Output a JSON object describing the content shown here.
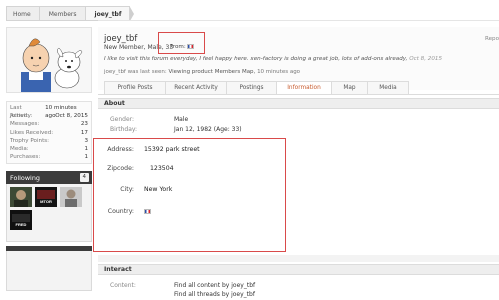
{
  "breadcrumb": [
    "Home",
    "Members",
    "joey_tbf"
  ],
  "profile": {
    "username": "joey_tbf",
    "title": "New Member, Male, 33",
    "from_label": "From:",
    "report": "Repo",
    "status_text": "I like to visit this forum everyday, I feel happy here. xen-factory is doing a great job, lots of add-ons already,",
    "status_date": "Oct 8, 2015",
    "last_seen_prefix": "joey_tbf was last seen:",
    "last_seen_activity": "Viewing product Members Map,",
    "last_seen_time": "10 minutes ago"
  },
  "sidebar": {
    "stats": [
      {
        "label": "Last Activity:",
        "value": "10 minutes ago"
      },
      {
        "label": "Joined:",
        "value": "Oct 8, 2015"
      },
      {
        "label": "Messages:",
        "value": "23"
      },
      {
        "label": "Likes Received:",
        "value": "17"
      },
      {
        "label": "Trophy Points:",
        "value": "3"
      },
      {
        "label": "Media:",
        "value": "1"
      },
      {
        "label": "Purchases:",
        "value": "1"
      }
    ],
    "following_title": "Following",
    "following_count": "4",
    "following_thumbs": [
      "thumb-1",
      "thumb-2",
      "thumb-3",
      "thumb-4"
    ],
    "thumb_texts": [
      "",
      "MTOR",
      "",
      "FRED"
    ]
  },
  "tabs": [
    "Profile Posts",
    "Recent Activity",
    "Postings",
    "Information",
    "Map",
    "Media"
  ],
  "active_tab": "Information",
  "about": {
    "heading": "About",
    "gender_label": "Gender:",
    "gender_value": "Male",
    "birthday_label": "Birthday:",
    "birthday_value": "Jan 12, 1982 (Age: 33)"
  },
  "custom_fields": {
    "address_label": "Address:",
    "address_value": "15392 park street",
    "zipcode_label": "Zipcode:",
    "zipcode_value": "123504",
    "city_label": "City:",
    "city_value": "New York",
    "country_label": "Country:"
  },
  "interact": {
    "heading": "Interact",
    "content_label": "Content:",
    "links": [
      "Find all content by joey_tbf",
      "Find all threads by joey_tbf"
    ]
  },
  "colors": {
    "accent_tab": "#c85a2d",
    "highlight_border": "#d94a4a",
    "following_header": "#3b3b3b"
  }
}
